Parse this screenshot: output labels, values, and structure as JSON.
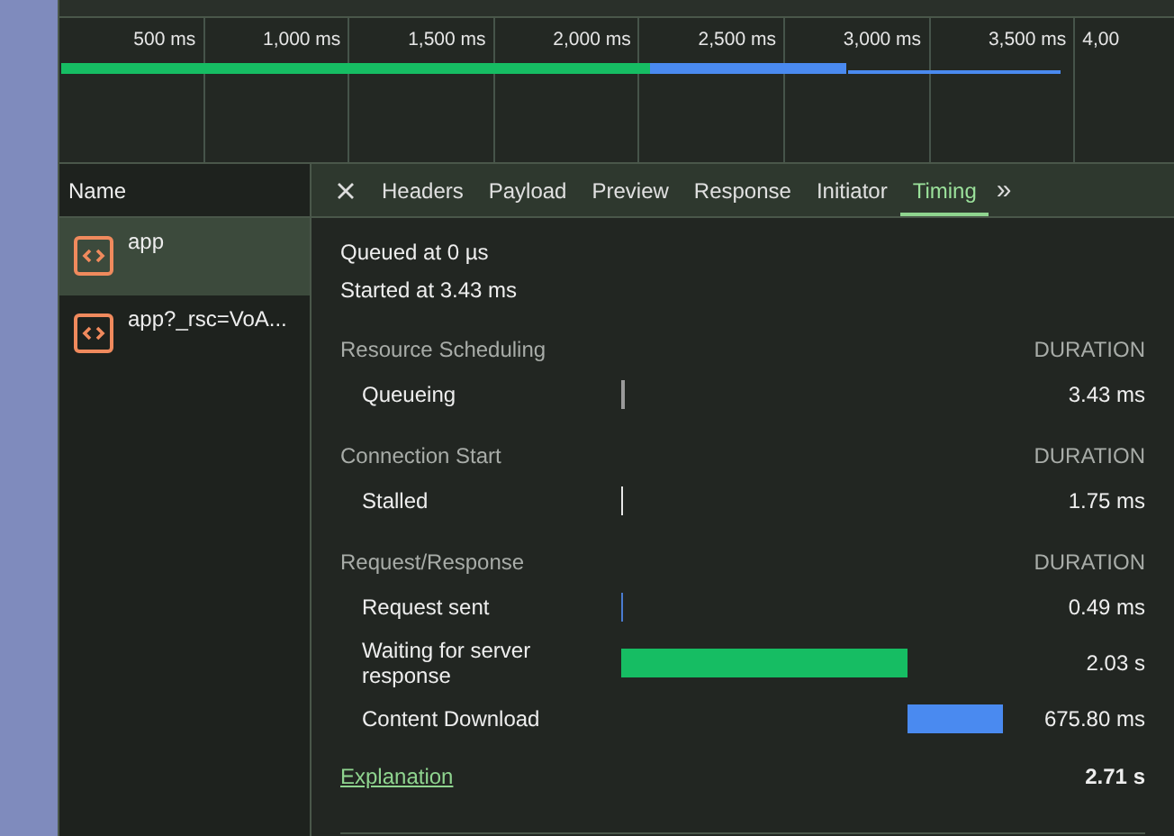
{
  "overview": {
    "ticks": [
      "500 ms",
      "1,000 ms",
      "1,500 ms",
      "2,000 ms",
      "2,500 ms",
      "3,000 ms",
      "3,500 ms",
      "4,00"
    ]
  },
  "requests": {
    "header": "Name",
    "items": [
      {
        "name": "app",
        "selected": true
      },
      {
        "name": "app?_rsc=VoA...",
        "selected": false
      }
    ]
  },
  "tabs": [
    {
      "label": "Headers",
      "selected": false
    },
    {
      "label": "Payload",
      "selected": false
    },
    {
      "label": "Preview",
      "selected": false
    },
    {
      "label": "Response",
      "selected": false
    },
    {
      "label": "Initiator",
      "selected": false
    },
    {
      "label": "Timing",
      "selected": true
    }
  ],
  "more_tabs": "»",
  "timing": {
    "queued": "Queued at 0 µs",
    "started": "Started at 3.43 ms",
    "sections": [
      {
        "title": "Resource Scheduling",
        "duration_label": "DURATION",
        "rows": [
          {
            "label": "Queueing",
            "color": "#9a9a9a",
            "value": "3.43 ms"
          }
        ]
      },
      {
        "title": "Connection Start",
        "duration_label": "DURATION",
        "rows": [
          {
            "label": "Stalled",
            "color": "#e8e8e8",
            "value": "1.75 ms"
          }
        ]
      },
      {
        "title": "Request/Response",
        "duration_label": "DURATION",
        "rows": [
          {
            "label": "Request sent",
            "color": "#4a7bd0",
            "value": "0.49 ms"
          },
          {
            "label": "Waiting for server response",
            "color": "#16bd63",
            "value": "2.03 s"
          },
          {
            "label": "Content Download",
            "color": "#4a8af0",
            "value": "675.80 ms"
          }
        ]
      }
    ],
    "explanation": "Explanation",
    "total": "2.71 s"
  }
}
